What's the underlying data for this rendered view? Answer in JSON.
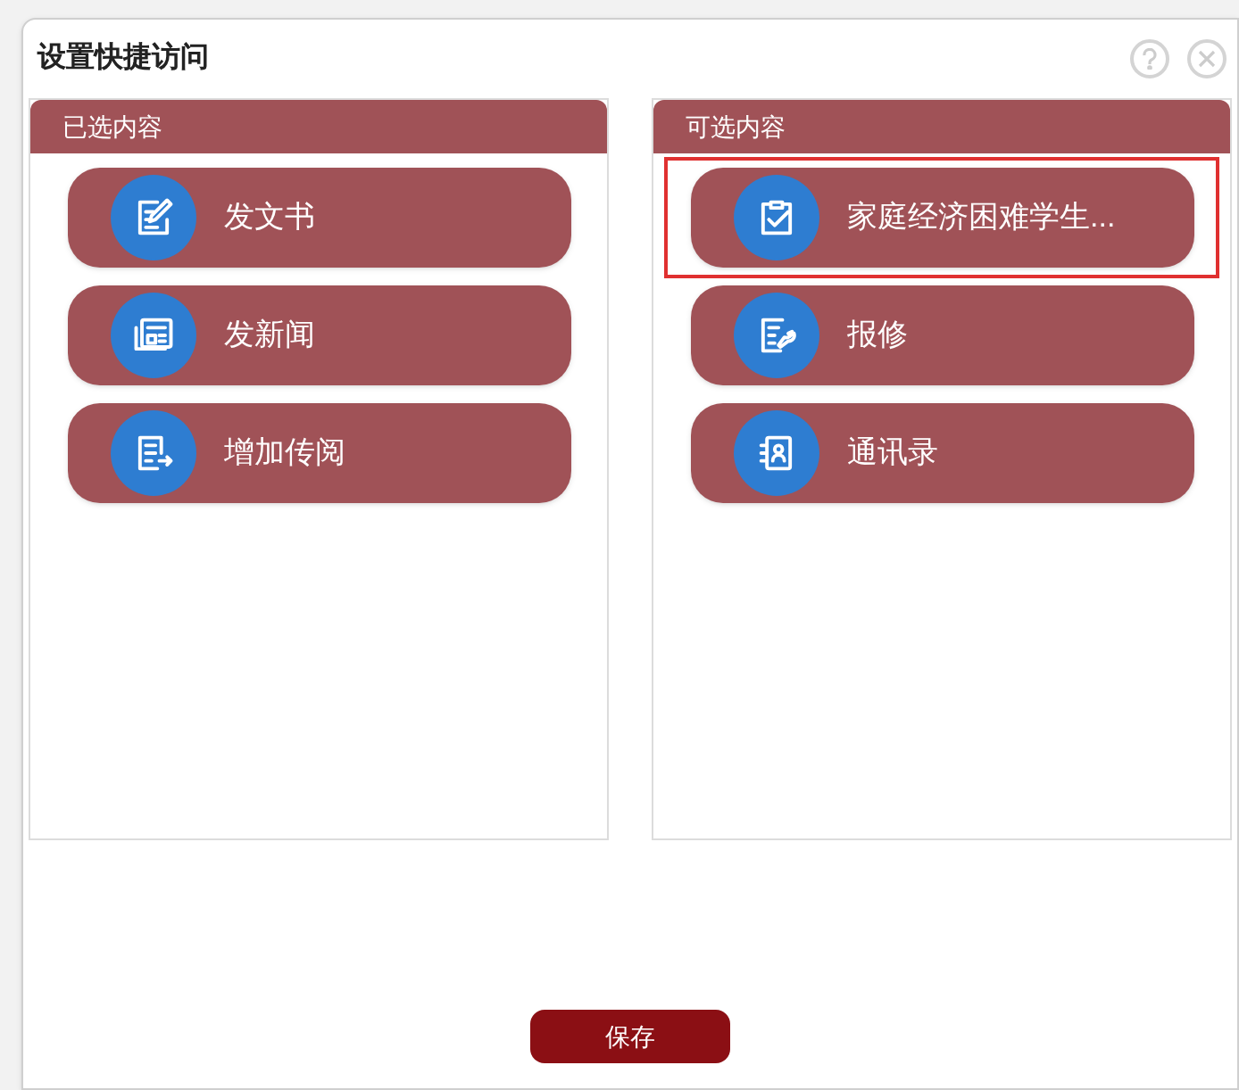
{
  "dialog": {
    "title": "设置快捷访问"
  },
  "selected_panel": {
    "title": "已选内容",
    "items": [
      {
        "label": "发文书",
        "selected": false
      },
      {
        "label": "发新闻",
        "selected": false
      },
      {
        "label": "增加传阅",
        "selected": false
      }
    ]
  },
  "available_panel": {
    "title": "可选内容",
    "items": [
      {
        "label": "家庭经济困难学生...",
        "selected": true
      },
      {
        "label": "报修",
        "selected": false
      },
      {
        "label": "通讯录",
        "selected": false
      }
    ]
  },
  "save_button": "保存"
}
